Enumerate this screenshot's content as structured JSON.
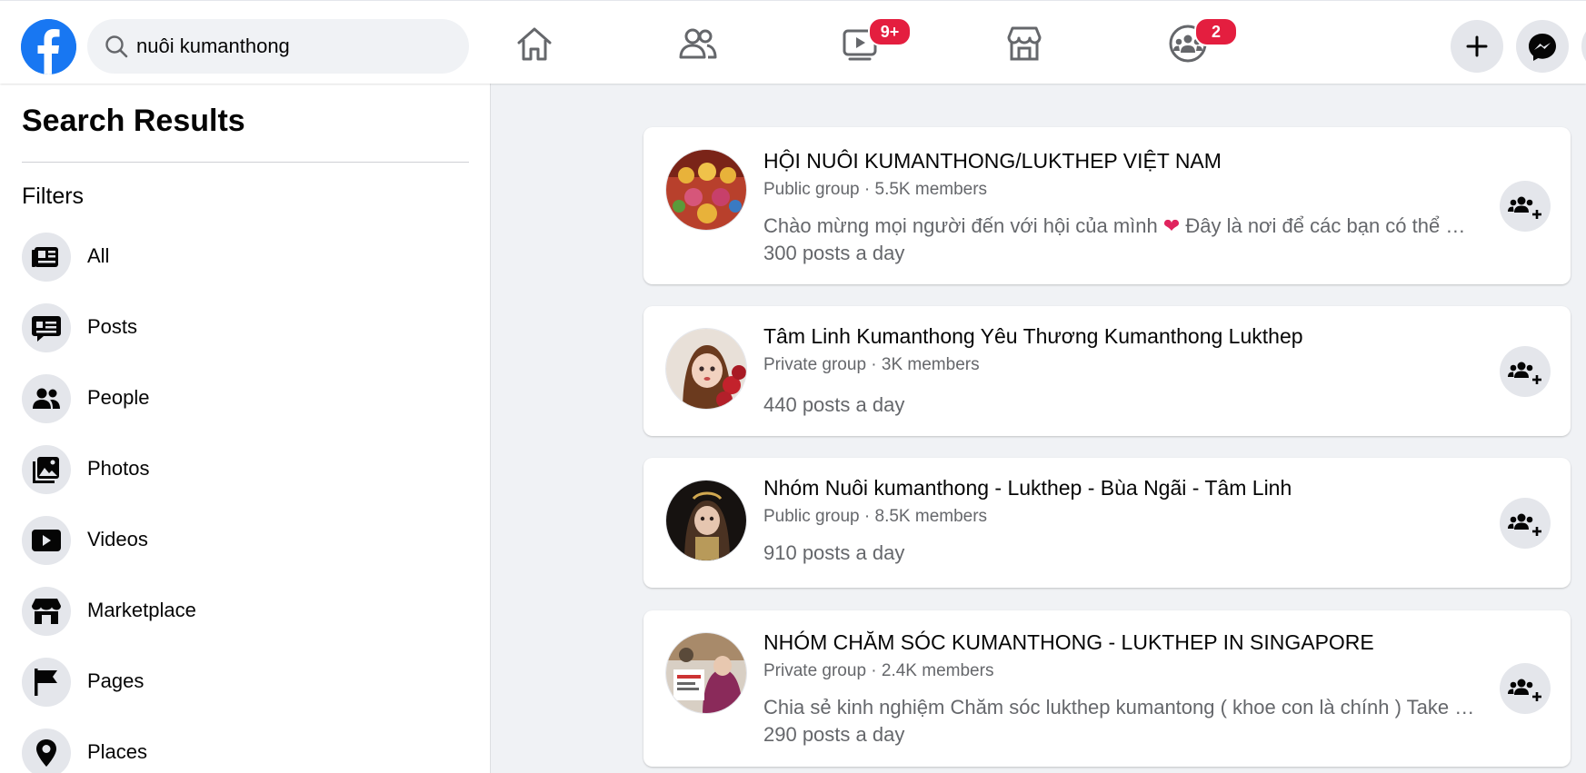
{
  "search": {
    "query": "nuôi kumanthong",
    "icon": "search-icon"
  },
  "nav": {
    "watch_badge": "9+",
    "groups_badge": "2",
    "accent_color": "#1877f2",
    "badge_color": "#e41e3f"
  },
  "sidebar": {
    "title": "Search Results",
    "filters_label": "Filters",
    "items": [
      {
        "label": "All",
        "icon": "newsfeed-icon"
      },
      {
        "label": "Posts",
        "icon": "posts-icon"
      },
      {
        "label": "People",
        "icon": "people-icon"
      },
      {
        "label": "Photos",
        "icon": "photos-icon"
      },
      {
        "label": "Videos",
        "icon": "videos-icon"
      },
      {
        "label": "Marketplace",
        "icon": "marketplace-icon"
      },
      {
        "label": "Pages",
        "icon": "pages-icon"
      },
      {
        "label": "Places",
        "icon": "places-icon"
      }
    ]
  },
  "results": [
    {
      "name": "HỘI NUÔI KUMANTHONG/LUKTHEP VIỆT NAM",
      "meta": "Public group · 5.5K members",
      "desc_before": "Chào mừng mọi người đến với hội của mình ",
      "desc_emoji": "❤",
      "desc_after": " Đây là nơi để các bạn có thể …",
      "posts": "300 posts a day"
    },
    {
      "name": "Tâm Linh Kumanthong Yêu Thương Kumanthong Lukthep",
      "meta": "Private group · 3K members",
      "posts": "440 posts a day"
    },
    {
      "name": "Nhóm Nuôi kumanthong - Lukthep - Bùa Ngãi - Tâm Linh",
      "meta": "Public group · 8.5K members",
      "posts": "910 posts a day"
    },
    {
      "name": "NHÓM CHĂM SÓC KUMANTHONG - LUKTHEP IN SINGAPORE",
      "meta": "Private group · 2.4K members",
      "desc": "Chia sẻ kinh nghiệm Chăm sóc lukthep kumantong ( khoe con là chính ) Take …",
      "posts": "290 posts a day"
    }
  ]
}
